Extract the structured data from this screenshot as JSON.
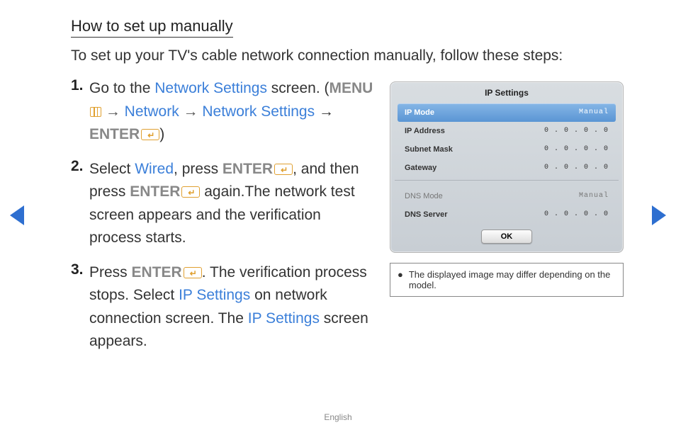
{
  "heading": "How to set up manually",
  "intro": "To set up your TV's cable network connection manually, follow these steps:",
  "steps": {
    "s1": {
      "num": "1.",
      "a": "Go to the ",
      "link1": "Network Settings",
      "b": " screen. (",
      "menu": "MENU",
      "arr": " → ",
      "link2": "Network",
      "link3": "Network Settings",
      "c": " → ",
      "enter": "ENTER",
      "d": ")"
    },
    "s2": {
      "num": "2.",
      "a": "Select ",
      "link1": "Wired",
      "b": ", press ",
      "enter": "ENTER",
      "c": ", and then press ",
      "d": " again.The network test screen appears and the verification process starts."
    },
    "s3": {
      "num": "3.",
      "a": "Press ",
      "enter": "ENTER",
      "b": ". The verification process stops. Select ",
      "link1": "IP Settings",
      "c": " on network connection screen. The ",
      "link2": "IP Settings",
      "d": " screen appears."
    }
  },
  "panel": {
    "title": "IP Settings",
    "rows": {
      "ipmode": {
        "label": "IP Mode",
        "val": "Manual"
      },
      "ipaddr": {
        "label": "IP Address",
        "val": "0 . 0 . 0 . 0"
      },
      "subnet": {
        "label": "Subnet Mask",
        "val": "0 . 0 . 0 . 0"
      },
      "gateway": {
        "label": "Gateway",
        "val": "0 . 0 . 0 . 0"
      },
      "dnsmode": {
        "label": "DNS Mode",
        "val": "Manual"
      },
      "dnsserver": {
        "label": "DNS Server",
        "val": "0 . 0 . 0 . 0"
      }
    },
    "ok": "OK"
  },
  "note": "The displayed image may differ depending on the model.",
  "footer": "English"
}
